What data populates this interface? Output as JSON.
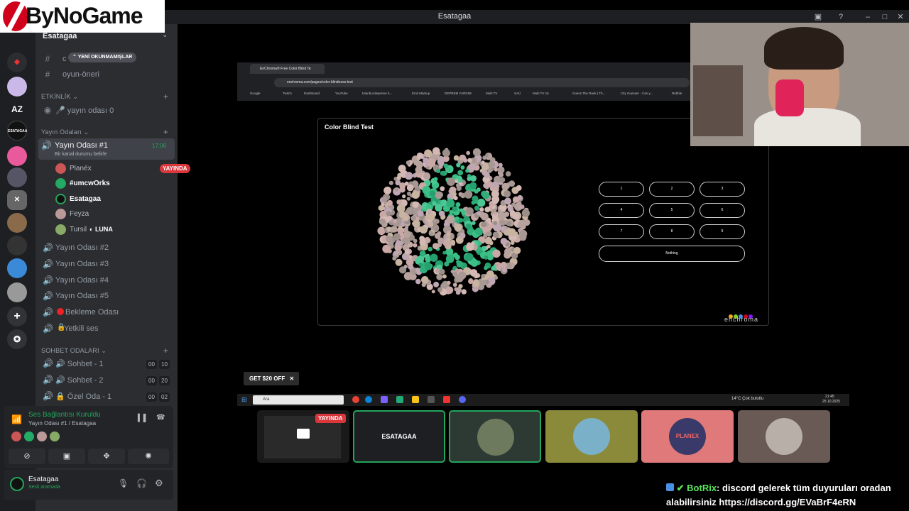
{
  "window": {
    "title": "Esatagaa"
  },
  "watermark": {
    "logo_text": "ByNoGame"
  },
  "rail": {
    "az_label": "AZ"
  },
  "server": {
    "name": "Esatagaa"
  },
  "sidebar": {
    "unread_pill": "YENİ OKUNMAMIŞLAR",
    "channels_top": [
      {
        "label": "c"
      },
      {
        "label": "oyun-öneri"
      }
    ],
    "events_category": "ETKİNLİK",
    "event_channel": "🎤 yayın odası 0",
    "stream_category": "Yayın Odaları",
    "active_room": {
      "label": "Yayın Odası #1",
      "status": "Bir kanal durumu belirle",
      "time": "17:06"
    },
    "members": [
      {
        "name": "Planéx",
        "badge": "YAYINDA"
      },
      {
        "name": "#umcwOrks"
      },
      {
        "name": "Esatagaa"
      },
      {
        "name": "Feyza"
      },
      {
        "name": "Tursil",
        "tag": "LUNA"
      }
    ],
    "rooms": [
      "Yayın Odası #2",
      "Yayın Odası #3",
      "Yayın Odası #4",
      "Yayın Odası #5",
      "Bekleme Odası",
      "Yetkili ses"
    ],
    "chat_category": "SOHBET ODALARI",
    "chat_rooms": [
      {
        "label": "Sohbet - 1",
        "c1": "00",
        "c2": "10"
      },
      {
        "label": "Sohbet - 2",
        "c1": "00",
        "c2": "20"
      },
      {
        "label": "Özel Oda - 1",
        "c1": "00",
        "c2": "02"
      }
    ]
  },
  "voice": {
    "status": "Ses Bağlantısı Kuruldu",
    "location": "Yayın Odası #1 / Esatagaa"
  },
  "user": {
    "name": "Esatagaa",
    "status": "Sesli aramada"
  },
  "stream": {
    "browser_tab": "EnChroma® Free Color Blind Te",
    "url": "enchroma.com/pages/color-blindness-test",
    "bookmarks": [
      "Google",
      "Twitch",
      "Dashboard",
      "YouTube",
      "İstanbul depreme h...",
      "Emit Markup",
      "DEPREM YARDIM",
      "Multi TV",
      "SAÜ",
      "Multi TV 16",
      "Guess The Rank | Th...",
      "City Guesser - Can y...",
      "Rebble"
    ],
    "test_title": "Color Blind Test",
    "answers": [
      "1",
      "2",
      "3",
      "4",
      "5",
      "6",
      "7",
      "8",
      "9"
    ],
    "nothing_label": "Nothing",
    "brand": "enchroma",
    "promo": "GET $20 OFF",
    "search_placeholder": "Ara",
    "weather": "14°C  Çok bulutlu",
    "clock_time": "21:45",
    "clock_date": "25.10.2025"
  },
  "tiles": [
    {
      "label": "",
      "badge": "YAYINDA"
    },
    {
      "label": "ESATAGAA"
    },
    {
      "label": ""
    },
    {
      "label": ""
    },
    {
      "label": "PLANEX"
    },
    {
      "label": ""
    }
  ],
  "chat": {
    "author": "BotRix",
    "message": ": discord gelerek tüm duyuruları oradan alabilirsiniz https://discord.gg/EVaBrF4eRN"
  },
  "colors": {
    "accent_green": "#23a55a",
    "live_red": "#da373c",
    "botrix_green": "#5ce65c"
  }
}
